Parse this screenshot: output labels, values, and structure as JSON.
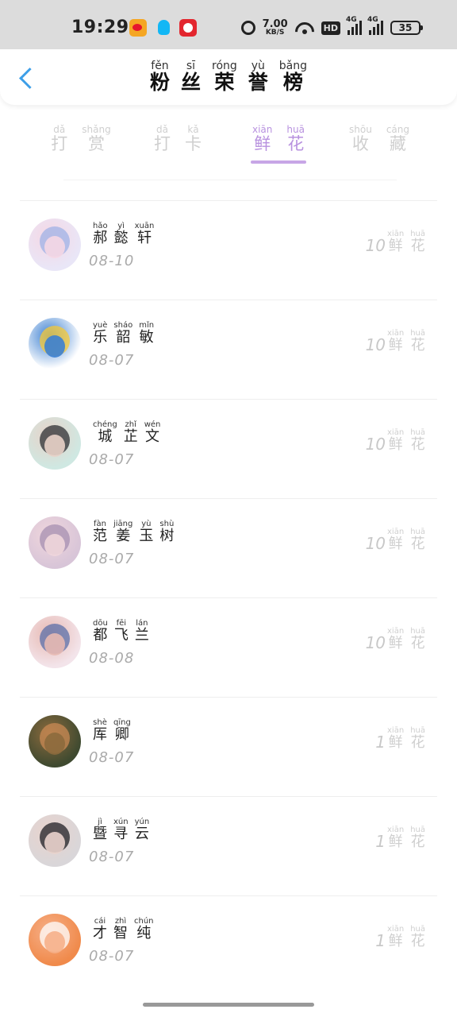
{
  "status_bar": {
    "time": "19:29",
    "network_speed": "7.00",
    "network_unit": "KB/S",
    "hd": "HD",
    "signal1": "4G",
    "signal2": "4G",
    "battery": "35"
  },
  "header": {
    "title": [
      {
        "hz": "粉",
        "py": "fěn"
      },
      {
        "hz": "丝",
        "py": "sī"
      },
      {
        "hz": "荣",
        "py": "róng"
      },
      {
        "hz": "誉",
        "py": "yù"
      },
      {
        "hz": "榜",
        "py": "bǎng"
      }
    ]
  },
  "tabs": [
    {
      "chars": [
        {
          "hz": "打",
          "py": "dǎ"
        },
        {
          "hz": "赏",
          "py": "shǎng"
        }
      ],
      "active": false
    },
    {
      "chars": [
        {
          "hz": "打",
          "py": "dǎ"
        },
        {
          "hz": "卡",
          "py": "kǎ"
        }
      ],
      "active": false
    },
    {
      "chars": [
        {
          "hz": "鲜",
          "py": "xiān"
        },
        {
          "hz": "花",
          "py": "huā"
        }
      ],
      "active": true
    },
    {
      "chars": [
        {
          "hz": "收",
          "py": "shōu"
        },
        {
          "hz": "藏",
          "py": "cáng"
        }
      ],
      "active": false
    }
  ],
  "gift_label": [
    {
      "hz": "鲜",
      "py": "xiān"
    },
    {
      "hz": "花",
      "py": "huā"
    }
  ],
  "fans": [
    {
      "name": [
        {
          "hz": "郝",
          "py": "hǎo"
        },
        {
          "hz": "懿",
          "py": "yì"
        },
        {
          "hz": "轩",
          "py": "xuān"
        }
      ],
      "date": "08-10",
      "count": "10",
      "avatar_colors": [
        "#e9e6f7",
        "#9fb1e6",
        "#f5d7e4"
      ]
    },
    {
      "name": [
        {
          "hz": "乐",
          "py": "yuè"
        },
        {
          "hz": "韶",
          "py": "sháo"
        },
        {
          "hz": "敏",
          "py": "mǐn"
        }
      ],
      "date": "08-07",
      "count": "10",
      "avatar_colors": [
        "#ffffff",
        "#f7c935",
        "#3b7fd1"
      ]
    },
    {
      "name": [
        {
          "hz": "城",
          "py": "chéng"
        },
        {
          "hz": "芷",
          "py": "zhǐ"
        },
        {
          "hz": "文",
          "py": "wén"
        }
      ],
      "date": "08-07",
      "count": "10",
      "avatar_colors": [
        "#cfe8e2",
        "#2d2f33",
        "#e8d2c8"
      ]
    },
    {
      "name": [
        {
          "hz": "范",
          "py": "fàn"
        },
        {
          "hz": "姜",
          "py": "jiāng"
        },
        {
          "hz": "玉",
          "py": "yù"
        },
        {
          "hz": "树",
          "py": "shù"
        }
      ],
      "date": "08-07",
      "count": "10",
      "avatar_colors": [
        "#d8c5d8",
        "#a58fb0",
        "#f0d6dc"
      ]
    },
    {
      "name": [
        {
          "hz": "都",
          "py": "dōu"
        },
        {
          "hz": "飞",
          "py": "fēi"
        },
        {
          "hz": "兰",
          "py": "lán"
        }
      ],
      "date": "08-08",
      "count": "10",
      "avatar_colors": [
        "#f3e4ea",
        "#5b6fa8",
        "#e7b9b2"
      ]
    },
    {
      "name": [
        {
          "hz": "厍",
          "py": "shè"
        },
        {
          "hz": "卿",
          "py": "qīng"
        }
      ],
      "date": "08-07",
      "count": "1",
      "avatar_colors": [
        "#3f4a30",
        "#c98a54",
        "#8c6a3d"
      ]
    },
    {
      "name": [
        {
          "hz": "暨",
          "py": "jì"
        },
        {
          "hz": "寻",
          "py": "xún"
        },
        {
          "hz": "云",
          "py": "yún"
        }
      ],
      "date": "08-07",
      "count": "1",
      "avatar_colors": [
        "#d9d6d9",
        "#1f1f24",
        "#e9d3cc"
      ]
    },
    {
      "name": [
        {
          "hz": "才",
          "py": "cái"
        },
        {
          "hz": "智",
          "py": "zhì"
        },
        {
          "hz": "纯",
          "py": "chún"
        }
      ],
      "date": "08-07",
      "count": "1",
      "avatar_colors": [
        "#f08a4b",
        "#ffffff",
        "#f6b089"
      ]
    }
  ],
  "colors": {
    "accent": "#b892df",
    "indicator": "#c7a6e6",
    "back": "#3d9fe8",
    "muted": "#cfcfcf"
  }
}
